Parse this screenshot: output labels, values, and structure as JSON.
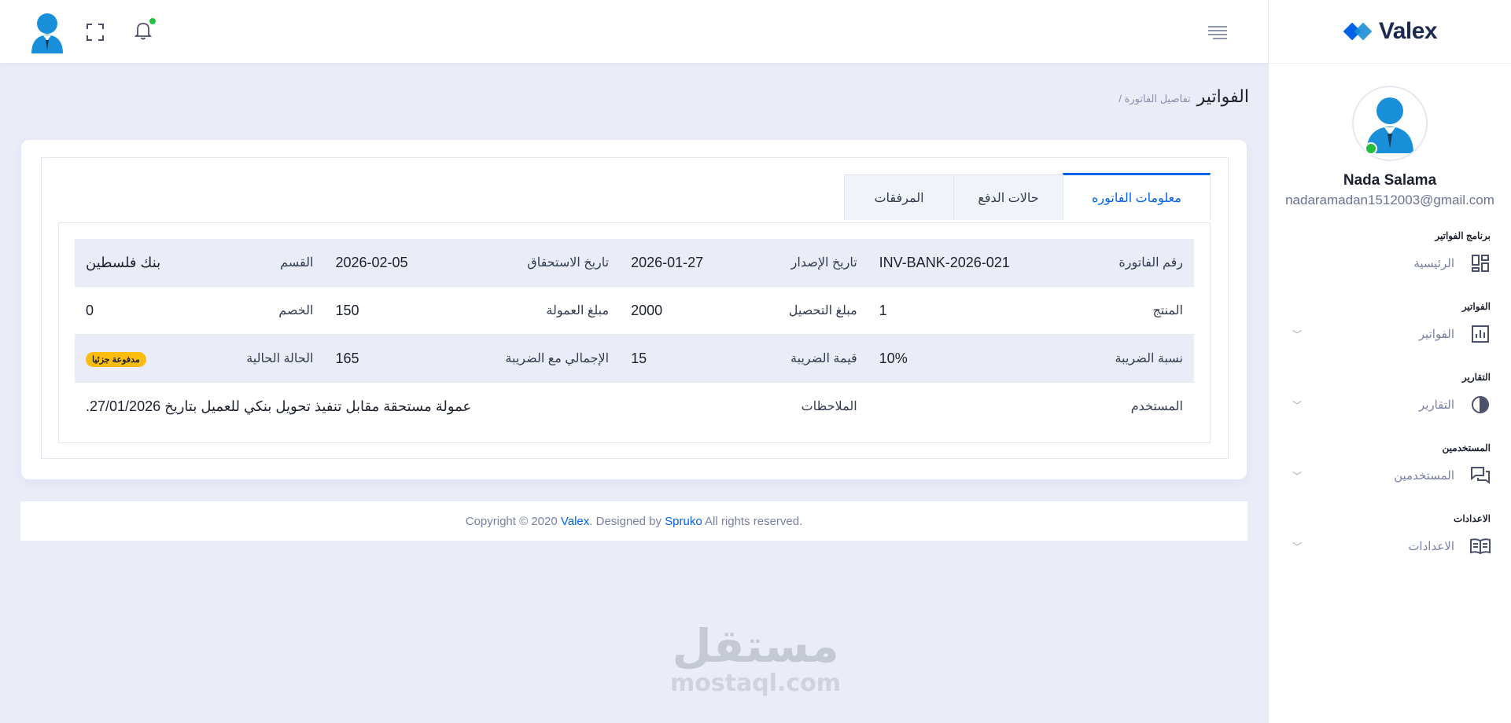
{
  "brand": {
    "name": "Valex",
    "colors": {
      "primary": "#0162e8",
      "accent": "#22c03c",
      "badge": "#fbbc0b"
    }
  },
  "header": {
    "icons": [
      "user-avatar",
      "expand-icon",
      "bell-icon",
      "menu-toggle-icon"
    ]
  },
  "sidebar": {
    "user": {
      "name": "Nada Salama",
      "email": "nadaramadan1512003@gmail.com"
    },
    "sections": [
      {
        "category": "برنامج الفواتير",
        "item": "الرئيسية",
        "icon": "dashboard-icon"
      },
      {
        "category": "الفواتير",
        "item": "الفواتير",
        "icon": "bar-chart-icon"
      },
      {
        "category": "التقارير",
        "item": "التقارير",
        "icon": "pie-chart-icon"
      },
      {
        "category": "المستخدمين",
        "item": "المستخدمين",
        "icon": "chat-icon"
      },
      {
        "category": "الاعدادات",
        "item": "الاعدادات",
        "icon": "book-icon"
      }
    ]
  },
  "page": {
    "title": "الفواتير",
    "breadcrumb": "/ تفاصيل الفاتورة"
  },
  "tabs": [
    "معلومات الفاتوره",
    "حالات الدفع",
    "المرفقات"
  ],
  "invoice": {
    "rows": [
      [
        {
          "label": "رقم الفاتورة",
          "value": "INV-BANK-2026-021"
        },
        {
          "label": "تاريخ الإصدار",
          "value": "2026-01-27"
        },
        {
          "label": "تاريخ الاستحقاق",
          "value": "2026-02-05"
        },
        {
          "label": "القسم",
          "value": "بنك فلسطين"
        }
      ],
      [
        {
          "label": "المنتج",
          "value": "1"
        },
        {
          "label": "مبلغ التحصيل",
          "value": "2000"
        },
        {
          "label": "مبلغ العمولة",
          "value": "150"
        },
        {
          "label": "الخصم",
          "value": "0"
        }
      ],
      [
        {
          "label": "نسبة الضريبة",
          "value": "10%"
        },
        {
          "label": "قيمة الضريبة",
          "value": "15"
        },
        {
          "label": "الإجمالي مع الضريبة",
          "value": "165"
        },
        {
          "label": "الحالة الحالية",
          "value": "مدفوعة جزئيا"
        }
      ]
    ],
    "user_label": "المستخدم",
    "notes_label": "الملاحظات",
    "notes_value": "عمولة مستحقة مقابل تنفيذ تحويل بنكي للعميل بتاريخ 27/01/2026."
  },
  "footer": {
    "prefix": "Copyright © 2020 ",
    "brand": "Valex",
    "middle": ". Designed by ",
    "designer": "Spruko",
    "suffix": " All rights reserved."
  },
  "watermark": {
    "arabic": "مستقل",
    "latin": "mostaql.com"
  }
}
